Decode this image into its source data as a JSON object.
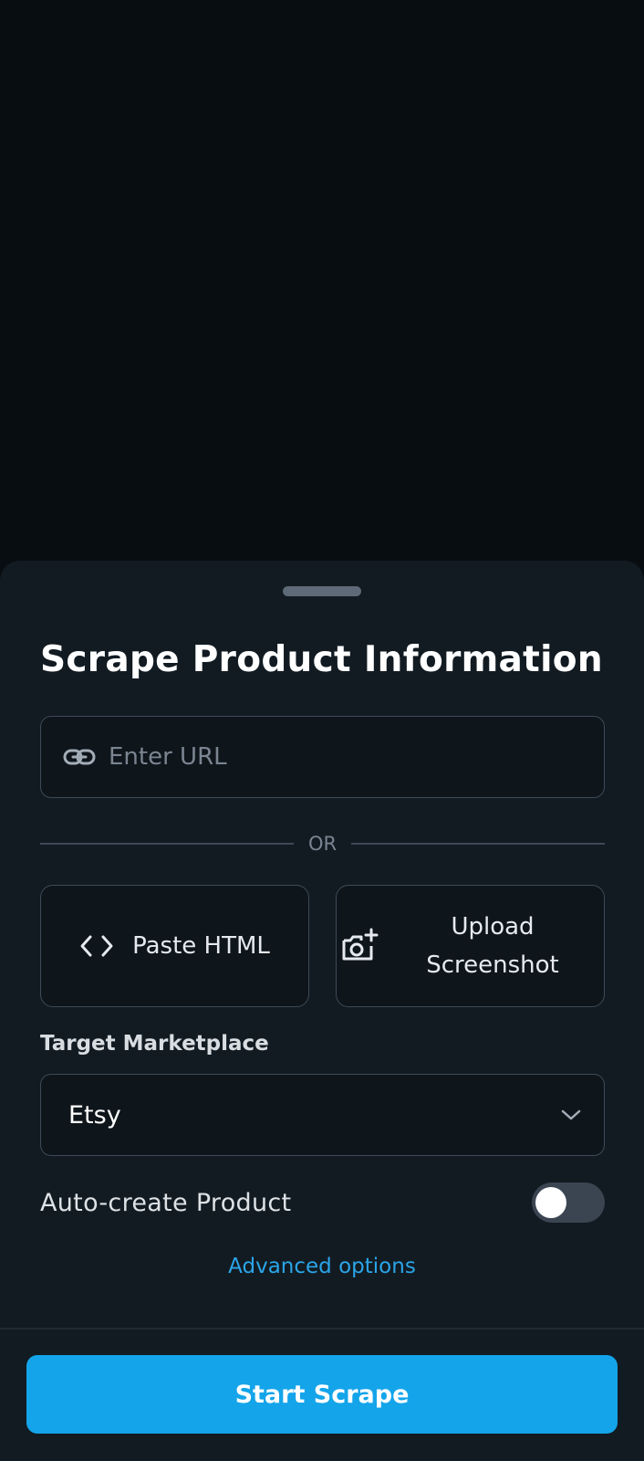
{
  "sheet": {
    "title": "Scrape Product Information",
    "url_input": {
      "placeholder": "Enter URL",
      "value": "",
      "icon": "link-icon"
    },
    "divider_text": "OR",
    "options": {
      "paste_html": {
        "label": "Paste HTML",
        "icon": "code-icon"
      },
      "upload_screenshot": {
        "label_line1": "Upload",
        "label_line2": "Screenshot",
        "icon": "camera-plus-icon"
      }
    },
    "marketplace": {
      "label": "Target Marketplace",
      "selected": "Etsy",
      "icon": "chevron-down-icon"
    },
    "auto_create": {
      "label": "Auto-create Product",
      "enabled": false
    },
    "advanced_link": "Advanced options",
    "primary_button": "Start Scrape"
  },
  "colors": {
    "background": "#080d11",
    "sheet": "#121b22",
    "accent": "#14a4ea",
    "link": "#2ba5e8"
  }
}
